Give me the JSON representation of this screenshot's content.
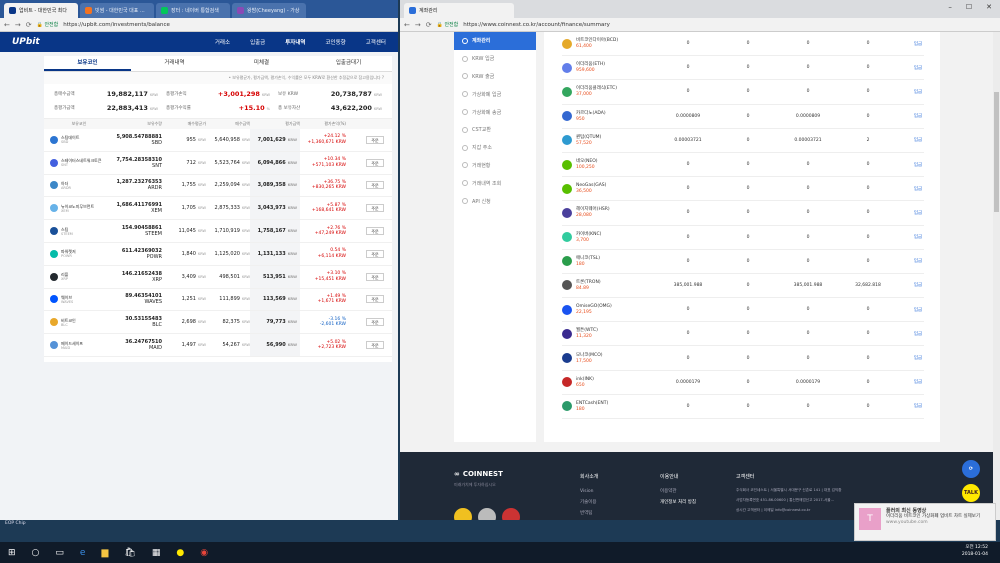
{
  "left_window": {
    "tabs": [
      {
        "label": "업비트 - 대한민국 최다"
      },
      {
        "label": "빗썸 - 대한민국 대표 ..."
      },
      {
        "label": "장터 : 네이버 통합검색"
      },
      {
        "label": "왕밤(Cheeyang) - 가상"
      }
    ],
    "url": "https://upbit.com/investments/balance",
    "secure_label": "안전함",
    "logo": "UPbit",
    "nav": [
      "거래소",
      "입출금",
      "투자내역",
      "코인동향",
      "고객센터"
    ],
    "active_nav": "투자내역",
    "subtabs": [
      "보유코인",
      "거래내역",
      "미체결",
      "입출금대기"
    ],
    "notice": "• 보유평균가, 평가금액, 평가손익, 수익률은 모두 KRW로 환산한 추정값으로 참고용입니다 ?",
    "summary": [
      {
        "label": "총매수금액",
        "value": "19,882,117",
        "unit": "KRW"
      },
      {
        "label": "총평가손익",
        "value": "+3,001,298",
        "unit": "KRW",
        "red": true
      },
      {
        "label": "보유 KRW",
        "value": "20,738,787",
        "unit": "KRW"
      },
      {
        "label": "총평가금액",
        "value": "22,883,413",
        "unit": "KRW"
      },
      {
        "label": "총평가수익률",
        "value": "+15.10",
        "unit": "%",
        "red": true
      },
      {
        "label": "총 보유자산",
        "value": "43,622,200",
        "unit": "KRW"
      }
    ],
    "columns": [
      "보유코인",
      "보유수량",
      "매수평균가",
      "매수금액",
      "평가금액",
      "평가손익(%)",
      ""
    ],
    "sell_label": "주문",
    "rows": [
      {
        "name": "스팀데이트",
        "sym": "SBD",
        "qty": "5,908.54788881",
        "qunit": "SBD",
        "avg": "955",
        "buy": "5,640,958",
        "eval": "7,001,629",
        "pl1": "+24.12 %",
        "pl2": "+1,360,671 KRW",
        "up": true,
        "color": "#2c75d2"
      },
      {
        "name": "스테이터스네트워크토큰",
        "sym": "SNT",
        "qty": "7,754.28358310",
        "qunit": "SNT",
        "avg": "712",
        "buy": "5,523,764",
        "eval": "6,094,866",
        "pl1": "+10.34 %",
        "pl2": "+571,103 KRW",
        "up": true,
        "color": "#4360df"
      },
      {
        "name": "아더",
        "sym": "ARDR",
        "qty": "1,287.23276353",
        "qunit": "ARDR",
        "avg": "1,755",
        "buy": "2,259,094",
        "eval": "3,089,358",
        "pl1": "+36.75 %",
        "pl2": "+830,265 KRW",
        "up": true,
        "color": "#3c87c7"
      },
      {
        "name": "뉴이코노미무브먼트",
        "sym": "XEM",
        "qty": "1,686.41176991",
        "qunit": "XEM",
        "avg": "1,705",
        "buy": "2,875,333",
        "eval": "3,043,973",
        "pl1": "+5.87 %",
        "pl2": "+168,641 KRW",
        "up": true,
        "color": "#67b2e8"
      },
      {
        "name": "스팀",
        "sym": "STEEM",
        "qty": "154.90458861",
        "qunit": "STEEM",
        "avg": "11,045",
        "buy": "1,710,919",
        "eval": "1,758,167",
        "pl1": "+2.76 %",
        "pl2": "+47,249 KRW",
        "up": true,
        "color": "#1a5099"
      },
      {
        "name": "파워렛저",
        "sym": "POWR",
        "qty": "611.42369032",
        "qunit": "POWR",
        "avg": "1,840",
        "buy": "1,125,020",
        "eval": "1,131,133",
        "pl1": "0.54 %",
        "pl2": "+6,114 KRW",
        "up": true,
        "color": "#05bca9"
      },
      {
        "name": "리플",
        "sym": "XRP",
        "qty": "146.21652438",
        "qunit": "XRP",
        "avg": "3,409",
        "buy": "498,501",
        "eval": "513,951",
        "pl1": "+3.10 %",
        "pl2": "+15,451 KRW",
        "up": true,
        "color": "#23292f"
      },
      {
        "name": "웨이브",
        "sym": "WAVES",
        "qty": "89.46354101",
        "qunit": "WAVES",
        "avg": "1,251",
        "buy": "111,899",
        "eval": "113,569",
        "pl1": "+1.49 %",
        "pl2": "+1,671 KRW",
        "up": true,
        "color": "#0155ff"
      },
      {
        "name": "비트코인",
        "sym": "BLC",
        "qty": "30.53155483",
        "qunit": "BLC",
        "avg": "2,698",
        "buy": "82,375",
        "eval": "79,773",
        "pl1": "-3.16 %",
        "pl2": "-2,601 KRW",
        "up": false,
        "color": "#e8a82b"
      },
      {
        "name": "메이드세이프",
        "sym": "MAID",
        "qty": "36.24767510",
        "qunit": "MAID",
        "avg": "1,497",
        "buy": "54,267",
        "eval": "56,990",
        "pl1": "+5.02 %",
        "pl2": "+2,723 KRW",
        "up": true,
        "color": "#5592d7"
      }
    ]
  },
  "right_window": {
    "tab": "계좌관리",
    "url": "https://www.coinnest.co.kr/account/finance/summary",
    "secure_label": "안전함",
    "sidebar": [
      "계좌관리",
      "KRW 입금",
      "KRW 출금",
      "가상화폐 입금",
      "가상화폐 송금",
      "CST교환",
      "지갑 주소",
      "거래현황",
      "거래내역 조회",
      "API 신청"
    ],
    "active_sidebar": "계좌관리",
    "link_label": "입금",
    "coins": [
      {
        "name": "비트코인다이아(BCD)",
        "price": "61,400",
        "v1": "0",
        "v2": "0",
        "v3": "0",
        "v4": "0",
        "color": "#e5a929"
      },
      {
        "name": "이더리움(ETH)",
        "price": "959,600",
        "v1": "0",
        "v2": "0",
        "v3": "0",
        "v4": "0",
        "color": "#627eea"
      },
      {
        "name": "이더리움클래식(ETC)",
        "price": "37,000",
        "v1": "0",
        "v2": "0",
        "v3": "0",
        "v4": "0",
        "color": "#33a65e"
      },
      {
        "name": "카르다노(ADA)",
        "price": "950",
        "v1": "0.0000809",
        "v2": "0",
        "v3": "0.0000809",
        "v4": "0",
        "color": "#3468d1"
      },
      {
        "name": "퀀텀(QTUM)",
        "price": "57,520",
        "v1": "0.00003721",
        "v2": "0",
        "v3": "0.00003721",
        "v4": "2",
        "color": "#2e9ad0"
      },
      {
        "name": "네오(NEO)",
        "price": "100,250",
        "v1": "0",
        "v2": "0",
        "v3": "0",
        "v4": "0",
        "color": "#58bf00"
      },
      {
        "name": "NeoGas(GAS)",
        "price": "36,500",
        "v1": "0",
        "v2": "0",
        "v3": "0",
        "v4": "0",
        "color": "#58bf00"
      },
      {
        "name": "헤이지웨어(HSR)",
        "price": "28,080",
        "v1": "0",
        "v2": "0",
        "v3": "0",
        "v4": "0",
        "color": "#4a3f9c"
      },
      {
        "name": "카이버(KNC)",
        "price": "3,700",
        "v1": "0",
        "v2": "0",
        "v3": "0",
        "v4": "0",
        "color": "#31cb9e"
      },
      {
        "name": "애니코(TSL)",
        "price": "180",
        "v1": "0",
        "v2": "0",
        "v3": "0",
        "v4": "0",
        "color": "#2a9d4b"
      },
      {
        "name": "트론(TRON)",
        "price": "84.89",
        "v1": "385,001.988",
        "v2": "0",
        "v3": "385,001.988",
        "v4": "32,682.818",
        "color": "#555555"
      },
      {
        "name": "OmiseGO(OMG)",
        "price": "22,195",
        "v1": "0",
        "v2": "0",
        "v3": "0",
        "v4": "0",
        "color": "#1a53f0"
      },
      {
        "name": "월튼(WTC)",
        "price": "11,320",
        "v1": "0",
        "v2": "0",
        "v3": "0",
        "v4": "0",
        "color": "#3a2a8f"
      },
      {
        "name": "모나코(MCO)",
        "price": "17,500",
        "v1": "0",
        "v2": "0",
        "v3": "0",
        "v4": "0",
        "color": "#1a3c8f"
      },
      {
        "name": "ink(INK)",
        "price": "650",
        "v1": "0.0000179",
        "v2": "0",
        "v3": "0.0000179",
        "v4": "0",
        "color": "#c62828"
      },
      {
        "name": "ENTCash(ENT)",
        "price": "180",
        "v1": "0",
        "v2": "0",
        "v3": "0",
        "v4": "0",
        "color": "#2c9a6a"
      }
    ],
    "footer": {
      "logo": "COINNEST",
      "sub": "미래가치에 투자하십시오",
      "col1_title": "회사소개",
      "col1": [
        "Vision",
        "기술이용",
        "번역팀"
      ],
      "col2_title": "이용안내",
      "col2": [
        "이용약관",
        "개인정보 처리 방침"
      ],
      "col3_title": "고객센터",
      "col3": [
        "주식회사 코인네스트 | 서울특별시 서대문구 신촌로 141 | 대표 김익환",
        "사업자등록번호 451-86-00600 | 통신판매업신고 2017-서울...",
        "상시간 고객센터 | 이메일 info@coinnest.co.kr"
      ]
    }
  },
  "toast": {
    "title": "플러의 최신 동영상",
    "body": "이더리움 비트코인 가상화폐 업비트 차트 실제보기",
    "source": "www.youtube.com"
  },
  "desktop_label": "EOP Chip",
  "clock": {
    "time": "오전 12:52",
    "date": "2018-01-04"
  }
}
